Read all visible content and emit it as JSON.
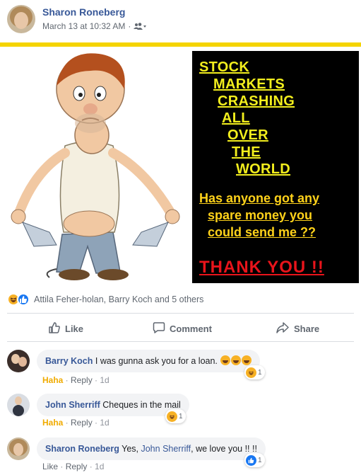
{
  "post": {
    "author": "Sharon Roneberg",
    "timestamp": "March 13 at 10:32 AM",
    "separator": "·",
    "audience_icon": "friends-icon"
  },
  "meme": {
    "lines": [
      "STOCK",
      "MARKETS",
      "CRASHING",
      "ALL",
      "OVER",
      "THE",
      "WORLD"
    ],
    "question": [
      "Has anyone got any",
      "spare money you",
      "could send me ??"
    ],
    "thanks": "THANK  YOU  !!",
    "colors": {
      "headline": "#f2ee1d",
      "question": "#ffd21a",
      "thanks": "#e8141b",
      "panel": "#000000",
      "border": "#f5d400"
    }
  },
  "reactions": {
    "icons": [
      "haha-icon",
      "like-icon"
    ],
    "names": "Attila Feher-holan, Barry Koch and 5 others"
  },
  "actions": {
    "like": "Like",
    "comment": "Comment",
    "share": "Share"
  },
  "comments": [
    {
      "name": "Barry Koch",
      "text": "I was gunna ask you for a loan.",
      "emoji_count": 3,
      "reaction_label": "Haha",
      "reply": "Reply",
      "age": "1d",
      "reaction_icon": "haha-icon",
      "reaction_count": "1"
    },
    {
      "name": "John Sherriff",
      "text": "Cheques in the mail",
      "reaction_label": "Haha",
      "reply": "Reply",
      "age": "1d",
      "reaction_icon": "haha-icon",
      "reaction_count": "1"
    },
    {
      "name": "Sharon Roneberg",
      "text_before": "Yes,",
      "mention": "John Sherriff",
      "text_after": ", we love you !! !!",
      "reaction_label": "Like",
      "reply": "Reply",
      "age": "1d",
      "reaction_icon": "like-icon",
      "reaction_count": "1"
    }
  ],
  "colors": {
    "link": "#385898",
    "meta": "#606770",
    "haha": "#f7b125",
    "like": "#1877f2"
  }
}
